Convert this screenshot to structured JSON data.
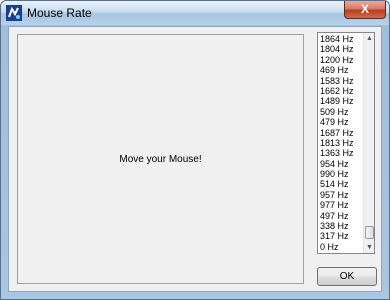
{
  "window": {
    "title": "Mouse Rate",
    "close_symbol": "X"
  },
  "pad": {
    "text": "Move your Mouse!"
  },
  "rates": [
    "1864 Hz",
    "1804 Hz",
    "1200 Hz",
    "469 Hz",
    "1583 Hz",
    "1662 Hz",
    "1489 Hz",
    "509 Hz",
    "479 Hz",
    "1687 Hz",
    "1813 Hz",
    "1363 Hz",
    "954 Hz",
    "990 Hz",
    "514 Hz",
    "957 Hz",
    "977 Hz",
    "497 Hz",
    "338 Hz",
    "317 Hz",
    "0 Hz"
  ],
  "scroll_arrows": {
    "up": "▲",
    "down": "▼"
  },
  "buttons": {
    "ok": "OK"
  },
  "icons": {
    "app": "mouse-rate-app-icon",
    "close": "close-icon"
  }
}
